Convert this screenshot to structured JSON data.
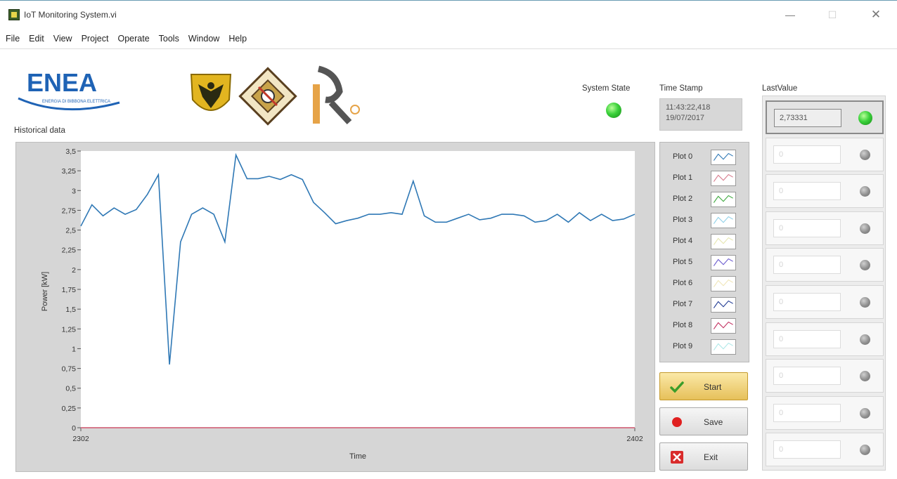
{
  "window": {
    "title": "IoT Monitoring System.vi",
    "min_glyph": "—",
    "max_glyph": "☐",
    "close_glyph": "✕"
  },
  "menu": [
    "File",
    "Edit",
    "View",
    "Project",
    "Operate",
    "Tools",
    "Window",
    "Help"
  ],
  "logos": {
    "enea_text": "ENEA",
    "enea_subtitle": "ENERGIA DI BIBBONA ELETTRICA"
  },
  "system_state": {
    "label": "System State",
    "led": "on",
    "led_color": "#3bd13b"
  },
  "time_stamp": {
    "label": "Time Stamp",
    "time": "11:43:22,418",
    "date": "19/07/2017"
  },
  "graph": {
    "label": "Historical data",
    "xlabel": "Time",
    "ylabel": "Power [kW]"
  },
  "chart_data": {
    "type": "line",
    "x": [
      2302,
      2304,
      2306,
      2308,
      2310,
      2312,
      2314,
      2316,
      2318,
      2320,
      2322,
      2324,
      2326,
      2328,
      2330,
      2332,
      2334,
      2336,
      2338,
      2340,
      2342,
      2344,
      2346,
      2348,
      2350,
      2352,
      2354,
      2356,
      2358,
      2360,
      2362,
      2364,
      2366,
      2368,
      2370,
      2372,
      2374,
      2376,
      2378,
      2380,
      2382,
      2384,
      2386,
      2388,
      2390,
      2392,
      2394,
      2396,
      2398,
      2400,
      2402
    ],
    "series": [
      {
        "values": [
          2.55,
          2.82,
          2.68,
          2.78,
          2.7,
          2.76,
          2.95,
          3.2,
          0.8,
          2.35,
          2.7,
          2.78,
          2.7,
          2.35,
          3.45,
          3.15,
          3.15,
          3.18,
          3.14,
          3.2,
          3.14,
          2.85,
          2.72,
          2.58,
          2.62,
          2.65,
          2.7,
          2.7,
          2.72,
          2.7,
          3.12,
          2.68,
          2.6,
          2.6,
          2.65,
          2.7,
          2.63,
          2.65,
          2.7,
          2.7,
          2.68,
          2.6,
          2.62,
          2.7,
          2.6,
          2.72,
          2.62,
          2.7,
          2.62,
          2.64,
          2.7
        ],
        "color": "#2f78b5"
      },
      {
        "values": [
          0,
          0,
          0,
          0,
          0,
          0,
          0,
          0,
          0,
          0,
          0,
          0,
          0,
          0,
          0,
          0,
          0,
          0,
          0,
          0,
          0,
          0,
          0,
          0,
          0,
          0,
          0,
          0,
          0,
          0,
          0,
          0,
          0,
          0,
          0,
          0,
          0,
          0,
          0,
          0,
          0,
          0,
          0,
          0,
          0,
          0,
          0,
          0,
          0,
          0,
          0
        ],
        "color": "#d77a8c"
      }
    ],
    "xlim": [
      2302,
      2402
    ],
    "ylim": [
      0,
      3.5
    ],
    "yticks": [
      "0",
      "0,25",
      "0,5",
      "0,75",
      "1",
      "1,25",
      "1,5",
      "1,75",
      "2",
      "2,25",
      "2,5",
      "2,75",
      "3",
      "3,25",
      "3,5"
    ],
    "xtick_labels": [
      "2302",
      "2402"
    ],
    "grid": false
  },
  "legend": [
    {
      "label": "Plot 0",
      "color": "#2f78b5"
    },
    {
      "label": "Plot 1",
      "color": "#d77a8c"
    },
    {
      "label": "Plot 2",
      "color": "#3ca83c"
    },
    {
      "label": "Plot 3",
      "color": "#8fd0e8"
    },
    {
      "label": "Plot 4",
      "color": "#e6e6b0"
    },
    {
      "label": "Plot 5",
      "color": "#6a5acd"
    },
    {
      "label": "Plot 6",
      "color": "#f0e6b8"
    },
    {
      "label": "Plot 7",
      "color": "#1f3a93"
    },
    {
      "label": "Plot 8",
      "color": "#c23060"
    },
    {
      "label": "Plot 9",
      "color": "#aee8e8"
    }
  ],
  "buttons": {
    "start": "Start",
    "save": "Save",
    "exit": "Exit"
  },
  "last_value": {
    "label": "LastValue",
    "items": [
      {
        "value": "2,73331",
        "led": "on"
      },
      {
        "value": "0",
        "led": "off"
      },
      {
        "value": "0",
        "led": "off"
      },
      {
        "value": "0",
        "led": "off"
      },
      {
        "value": "0",
        "led": "off"
      },
      {
        "value": "0",
        "led": "off"
      },
      {
        "value": "0",
        "led": "off"
      },
      {
        "value": "0",
        "led": "off"
      },
      {
        "value": "0",
        "led": "off"
      },
      {
        "value": "0",
        "led": "off"
      }
    ]
  }
}
